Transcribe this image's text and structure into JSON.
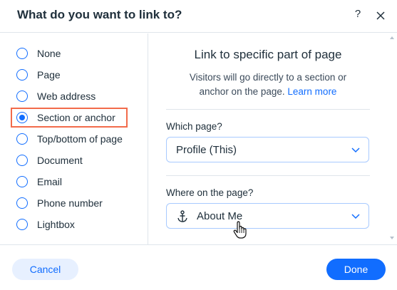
{
  "dialog": {
    "title": "What do you want to link to?",
    "help_label": "?"
  },
  "options": [
    {
      "label": "None",
      "checked": false
    },
    {
      "label": "Page",
      "checked": false
    },
    {
      "label": "Web address",
      "checked": false
    },
    {
      "label": "Section or anchor",
      "checked": true
    },
    {
      "label": "Top/bottom of page",
      "checked": false
    },
    {
      "label": "Document",
      "checked": false
    },
    {
      "label": "Email",
      "checked": false
    },
    {
      "label": "Phone number",
      "checked": false
    },
    {
      "label": "Lightbox",
      "checked": false
    }
  ],
  "panel": {
    "title": "Link to specific part of page",
    "desc_line1": "Visitors will go directly to a section or",
    "desc_line2": "anchor on the page.",
    "learn_more": "Learn more",
    "which_page_label": "Which page?",
    "which_page_value": "Profile (This)",
    "where_label": "Where on the page?",
    "where_value": "About Me"
  },
  "footer": {
    "cancel_label": "Cancel",
    "done_label": "Done"
  },
  "colors": {
    "accent": "#116dff",
    "highlight": "#f26b4b"
  },
  "icons": {
    "close": "close-icon",
    "chevron": "chevron-down-icon",
    "anchor": "anchor-icon",
    "cursor": "hand-pointer-icon"
  }
}
